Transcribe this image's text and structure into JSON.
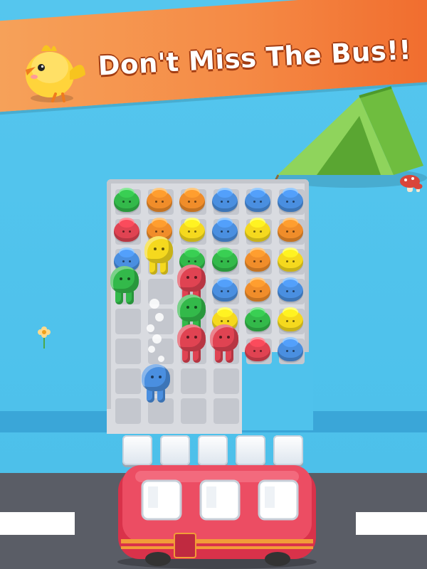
{
  "banner": {
    "title": "Don't Miss The Bus!!"
  },
  "colors": {
    "green": "#33b94a",
    "orange": "#f08d2a",
    "yellow": "#f5d91e",
    "blue": "#4a8fe0",
    "red": "#e04352",
    "banner_start": "#f6a25a",
    "banner_end": "#f06a2c",
    "bus": "#e0374f"
  },
  "grid": {
    "rows": [
      [
        "green",
        "orange",
        "orange",
        "blue",
        "blue",
        "blue"
      ],
      [
        "red",
        "orange",
        "yellow",
        "blue",
        "yellow",
        "orange"
      ],
      [
        "blue",
        "",
        "green",
        "green",
        "orange",
        "yellow"
      ],
      [
        "",
        "",
        "",
        "blue",
        "orange",
        "blue"
      ],
      [
        "",
        "",
        "",
        "yellow",
        "green",
        "yellow"
      ],
      [
        "",
        "",
        "",
        "",
        "red",
        "blue"
      ]
    ]
  },
  "walkers": [
    "yellow",
    "green",
    "red",
    "green",
    "red",
    "red",
    "blue"
  ],
  "bus_slots": [
    "",
    "",
    "",
    "",
    ""
  ],
  "icons": [
    "chick-icon",
    "tent-icon",
    "mushroom-icon",
    "flower-icon",
    "bus-icon"
  ]
}
